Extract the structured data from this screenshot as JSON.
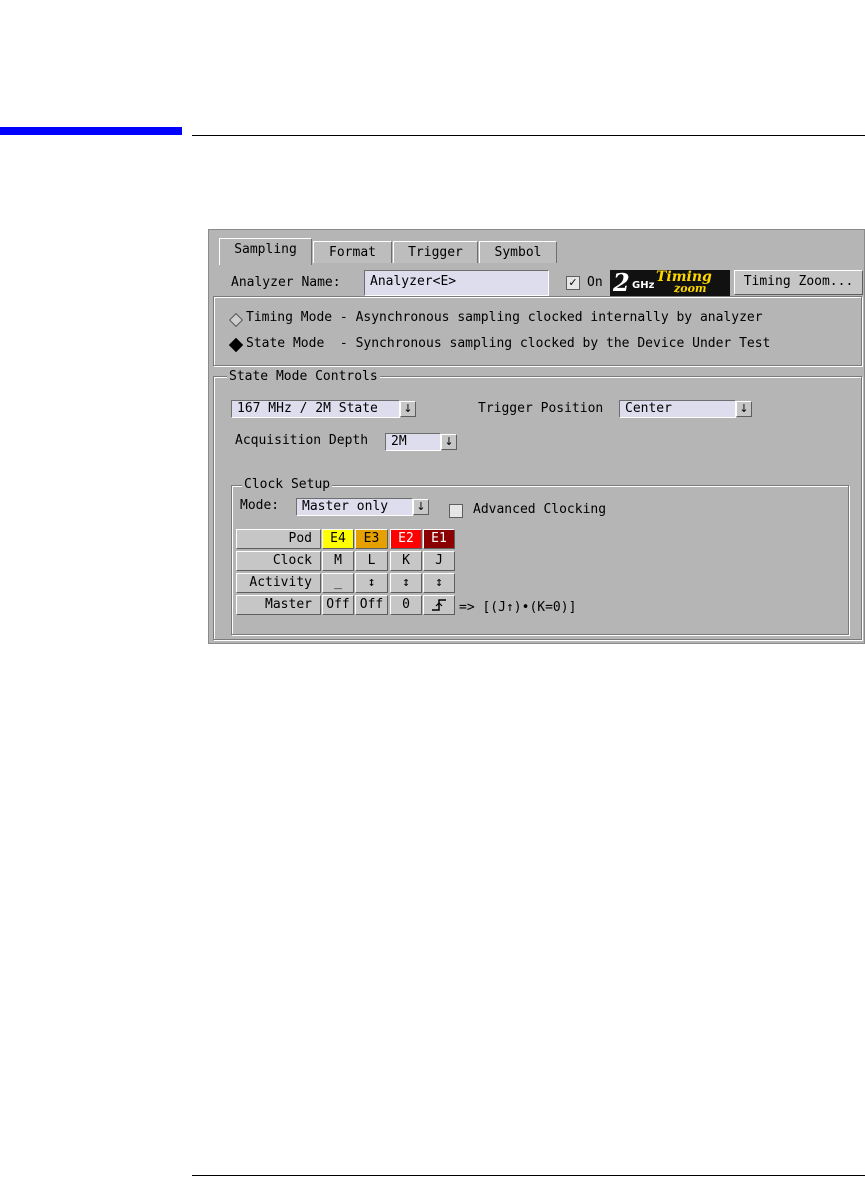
{
  "tabs": [
    "Sampling",
    "Format",
    "Trigger",
    "Symbol"
  ],
  "analyzer": {
    "name_label": "Analyzer Name:",
    "name_value": "Analyzer<E>",
    "on_label": "On",
    "on_checked": true,
    "logo": {
      "two": "2",
      "ghz": "GHz",
      "timing": "Timing",
      "zoom": "zoom"
    },
    "timing_zoom_button": "Timing Zoom..."
  },
  "modes": [
    {
      "label": "Timing Mode - Asynchronous sampling clocked internally by analyzer",
      "selected": false
    },
    {
      "label": "State Mode  - Synchronous sampling clocked by the Device Under Test",
      "selected": true
    }
  ],
  "state_controls": {
    "title": "State Mode Controls",
    "speed_value": "167 MHz / 2M State",
    "trigger_position_label": "Trigger Position",
    "trigger_position_value": "Center",
    "acq_depth_label": "Acquisition Depth",
    "acq_depth_value": "2M"
  },
  "clock_setup": {
    "title": "Clock Setup",
    "mode_label": "Mode:",
    "mode_value": "Master only",
    "advanced_label": "Advanced Clocking",
    "row_headers": [
      "Pod",
      "Clock",
      "Activity",
      "Master"
    ],
    "pods": [
      {
        "pod": "E4",
        "color": "#ffff00",
        "text_color": "#000000",
        "clock": "M",
        "activity": "_",
        "master": "Off"
      },
      {
        "pod": "E3",
        "color": "#e6a000",
        "text_color": "#000000",
        "clock": "L",
        "activity": "↕",
        "master": "Off"
      },
      {
        "pod": "E2",
        "color": "#ff0000",
        "text_color": "#ffffff",
        "clock": "K",
        "activity": "↕",
        "master": "0"
      },
      {
        "pod": "E1",
        "color": "#8b0000",
        "text_color": "#ffffff",
        "clock": "J",
        "activity": "↕",
        "master": "rising-edge-icon"
      }
    ],
    "equation": "=> [(J↑)•(K=0)]"
  },
  "icons": {
    "dropdown": "↓",
    "check": "✓"
  }
}
